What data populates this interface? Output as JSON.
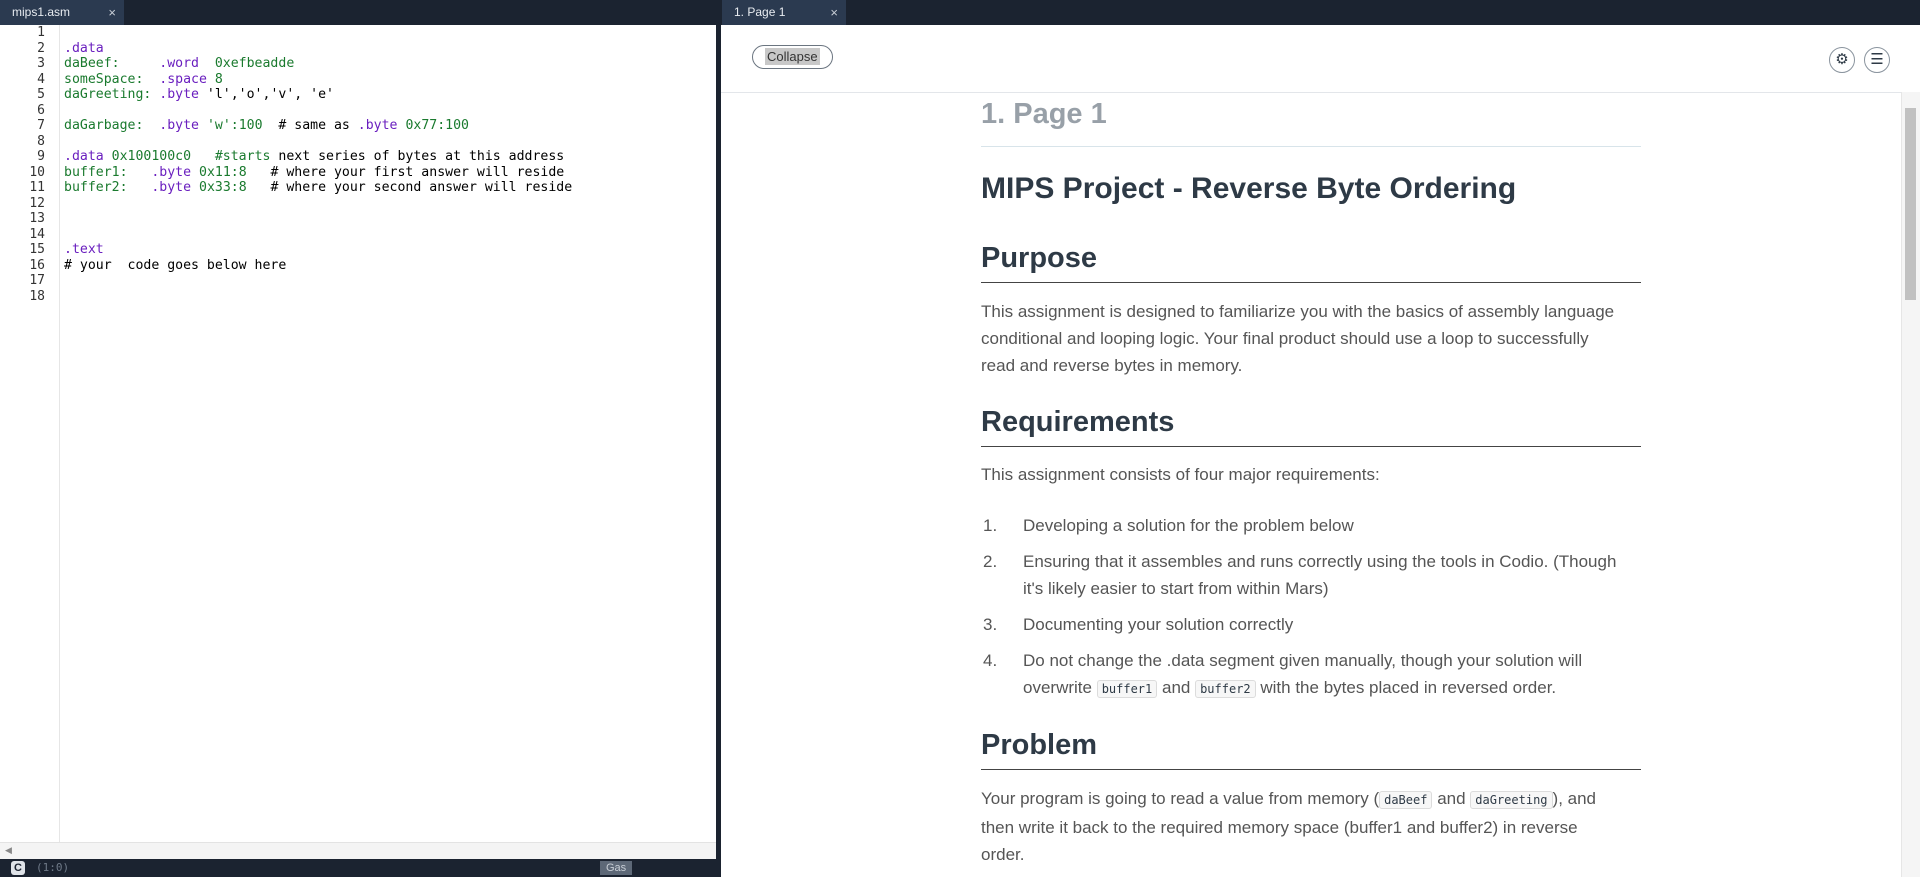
{
  "editor": {
    "tab_label": "mips1.asm",
    "tab_close": "×",
    "line_numbers": [
      "1",
      "2",
      "3",
      "4",
      "5",
      "6",
      "7",
      "8",
      "9",
      "10",
      "11",
      "12",
      "13",
      "14",
      "15",
      "16",
      "17",
      "18"
    ],
    "lines": {
      "l2": [
        ".data"
      ],
      "l3": [
        "daBeef:",
        "     .word  ",
        "0xefbeadde"
      ],
      "l4": [
        "someSpace:",
        "  .space ",
        "8"
      ],
      "l5": [
        "daGreeting:",
        " .byte ",
        "'l','o','v', 'e'"
      ],
      "l7": [
        "daGarbage:",
        "  .byte ",
        "'w':100",
        "  # same as ",
        ".byte ",
        "0x77:100"
      ],
      "l9": [
        ".data ",
        "0x100100c0",
        "   #starts",
        " next series of bytes at this address"
      ],
      "l10": [
        "buffer1:",
        "   .byte ",
        "0x11:8",
        "   # where your first answer will reside"
      ],
      "l11": [
        "buffer2:",
        "   .byte ",
        "0x33:8",
        "   # where your second answer will reside"
      ],
      "l15": [
        ".text"
      ],
      "l16": [
        "# your  code goes below here"
      ]
    },
    "status": {
      "logo": "C",
      "cursor_pos": "(1:0)",
      "mode": "Gas"
    }
  },
  "guide": {
    "tab_label": "1. Page 1",
    "tab_close": "×",
    "toolbar": {
      "collapse_label": "Collapse",
      "settings_icon": "gear-icon",
      "toc_icon": "list-icon"
    },
    "page_title": "1. Page 1",
    "doc_title": "MIPS Project - Reverse Byte Ordering",
    "purpose": {
      "heading": "Purpose",
      "text": "This assignment is designed to familiarize you with the basics of assembly language conditional and looping logic. Your final product should use a loop to successfully read and reverse bytes in memory."
    },
    "requirements": {
      "heading": "Requirements",
      "intro": "This assignment consists of four major requirements:",
      "items": [
        {
          "n": "1.",
          "text": "Developing a solution for the problem below"
        },
        {
          "n": "2.",
          "text": "Ensuring that it assembles and runs correctly using the tools in Codio. (Though it's likely easier to start from within Mars)"
        },
        {
          "n": "3.",
          "text": "Documenting your solution correctly"
        },
        {
          "n": "4.",
          "text_a": "Do not change the .data segment given manually, though your solution will overwrite ",
          "code_a": "buffer1",
          "text_b": " and ",
          "code_b": "buffer2",
          "text_c": " with the bytes placed in reversed order."
        }
      ]
    },
    "problem": {
      "heading": "Problem",
      "text_a": "Your program is going to read a value from memory (",
      "code_a": "daBeef",
      "text_b": " and ",
      "code_b": "daGreeting",
      "text_c": "), and then write it back to the required memory space (buffer1 and buffer2) in reverse order."
    }
  }
}
